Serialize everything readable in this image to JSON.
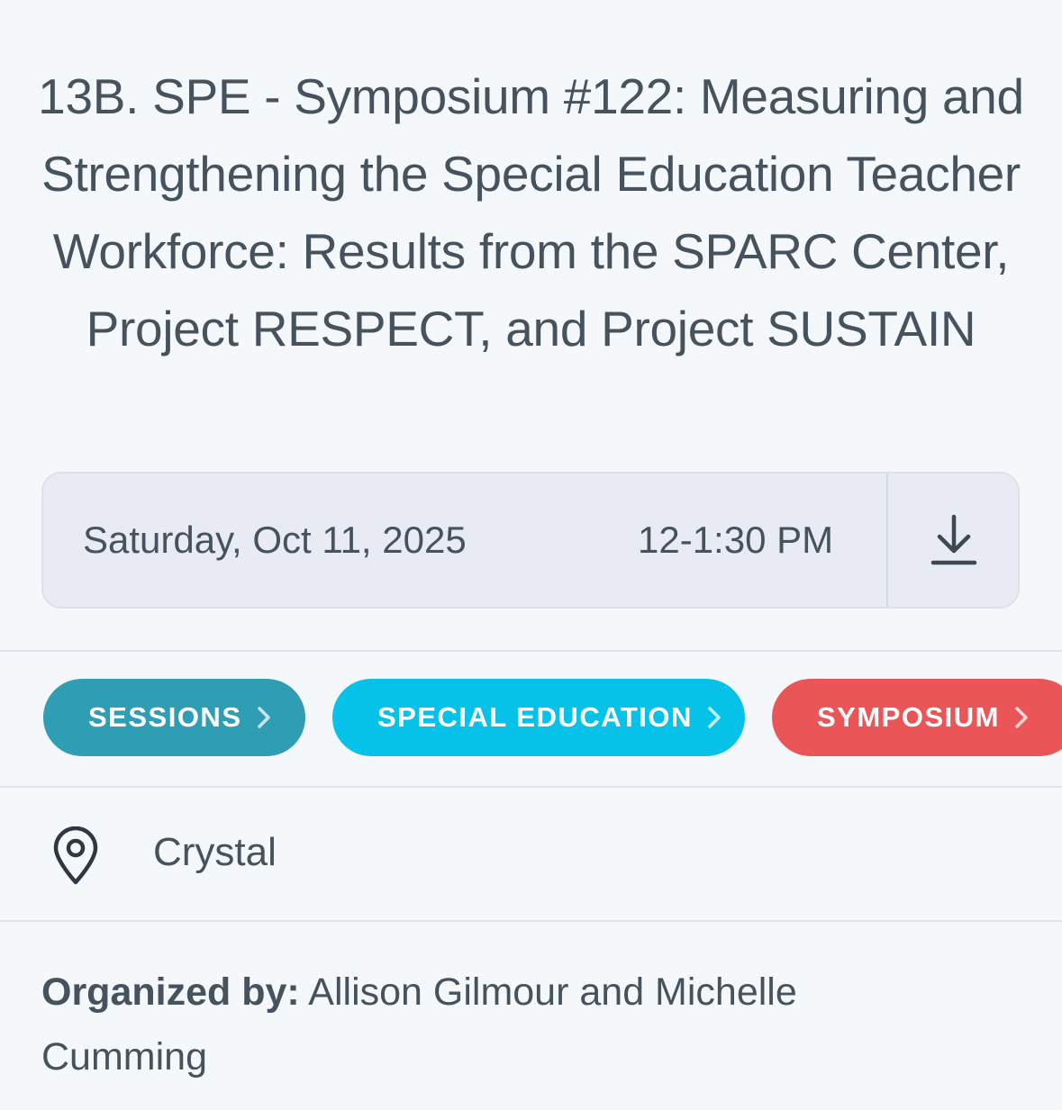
{
  "session": {
    "title": "13B. SPE - Symposium #122: Measuring and Strengthening the Special Education Teacher Workforce: Results from the SPARC Center, Project RESPECT, and Project SUSTAIN",
    "date": "Saturday, Oct 11, 2025",
    "time": "12-1:30 PM",
    "download_icon": "download-icon"
  },
  "tags": [
    {
      "label": "SESSIONS",
      "color": "#2f9db4"
    },
    {
      "label": "SPECIAL EDUCATION",
      "color": "#06c2e8"
    },
    {
      "label": "SYMPOSIUM",
      "color": "#ea5657"
    }
  ],
  "location": {
    "icon": "map-pin-icon",
    "name": "Crystal"
  },
  "organizer": {
    "label": "Organized by:",
    "names": "Allison Gilmour and Michelle Cumming"
  }
}
